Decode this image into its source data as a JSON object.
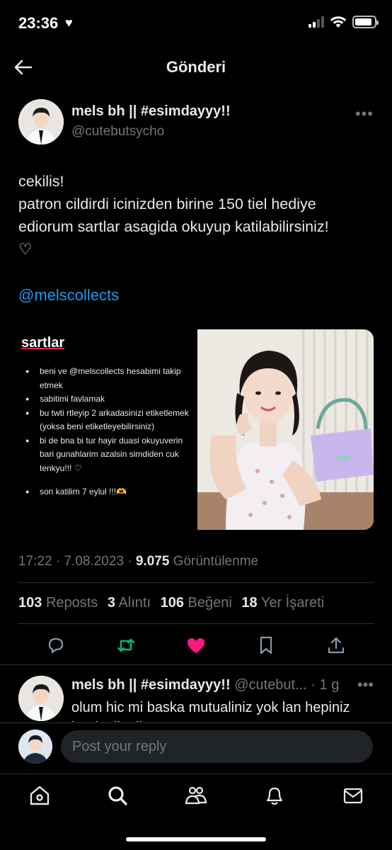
{
  "status_bar": {
    "time": "23:36",
    "heart": "♥"
  },
  "header": {
    "title": "Gönderi"
  },
  "post": {
    "author_name": "mels bh || #esimdayyy!!",
    "author_handle": "@cutebutsycho",
    "more": "•••",
    "text_lines": [
      "cekilis!",
      "patron cildirdi icinizden birine 150 tiel hediye",
      "ediorum sartlar asagida okuyup katilabilirsiniz!",
      "♡"
    ],
    "mention": "@melscollects",
    "media": {
      "rules_title": "sartlar",
      "rules": [
        "beni ve @melscollects hesabimi takip etmek",
        "sabitimi favlamak",
        "bu twti rtleyip 2 arkadasinizi etiketlemek (yoksa beni etiketleyebilirsiniz)",
        "bi de bna bi tur hayir duasi okuyuverin bari gunahlarim azalsin simdiden cuk tenkyu!!! ♡",
        "son katilim 7 eylul !!!🫶"
      ]
    },
    "time": "17:22",
    "date": "7.08.2023",
    "views_count": "9.075",
    "views_label": "Görüntülenme",
    "stats": {
      "reposts_count": "103",
      "reposts_label": "Reposts",
      "quotes_count": "3",
      "quotes_label": "Alıntı",
      "likes_count": "106",
      "likes_label": "Beğeni",
      "bookmarks_count": "18",
      "bookmarks_label": "Yer İşareti"
    },
    "like_color": "#f91880",
    "repost_color": "#00ba7c"
  },
  "reply": {
    "author_name": "mels bh || #esimdayyy!!",
    "author_handle": "@cutebut...",
    "age": "· 1 g",
    "more": "•••",
    "text": "olum hic mi baska mutualiniz yok lan hepiniz beni etiketliorsunuz"
  },
  "composer": {
    "placeholder": "Post your reply"
  },
  "nav": [
    "home-icon",
    "search-icon",
    "communities-icon",
    "notifications-icon",
    "messages-icon"
  ]
}
